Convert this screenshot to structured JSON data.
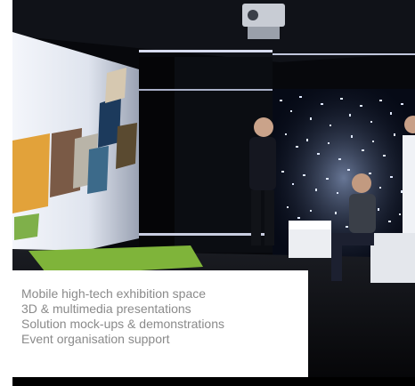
{
  "photo": {
    "subject": "exhibition-space-photo"
  },
  "caption": {
    "lines": [
      "Mobile high-tech exhibition space",
      "3D & multimedia presentations",
      "Solution mock-ups & demonstrations",
      "Event organisation support"
    ]
  },
  "colors": {
    "caption_text": "#8a8a8a",
    "caption_background": "#ffffff",
    "frame": "#000000"
  }
}
